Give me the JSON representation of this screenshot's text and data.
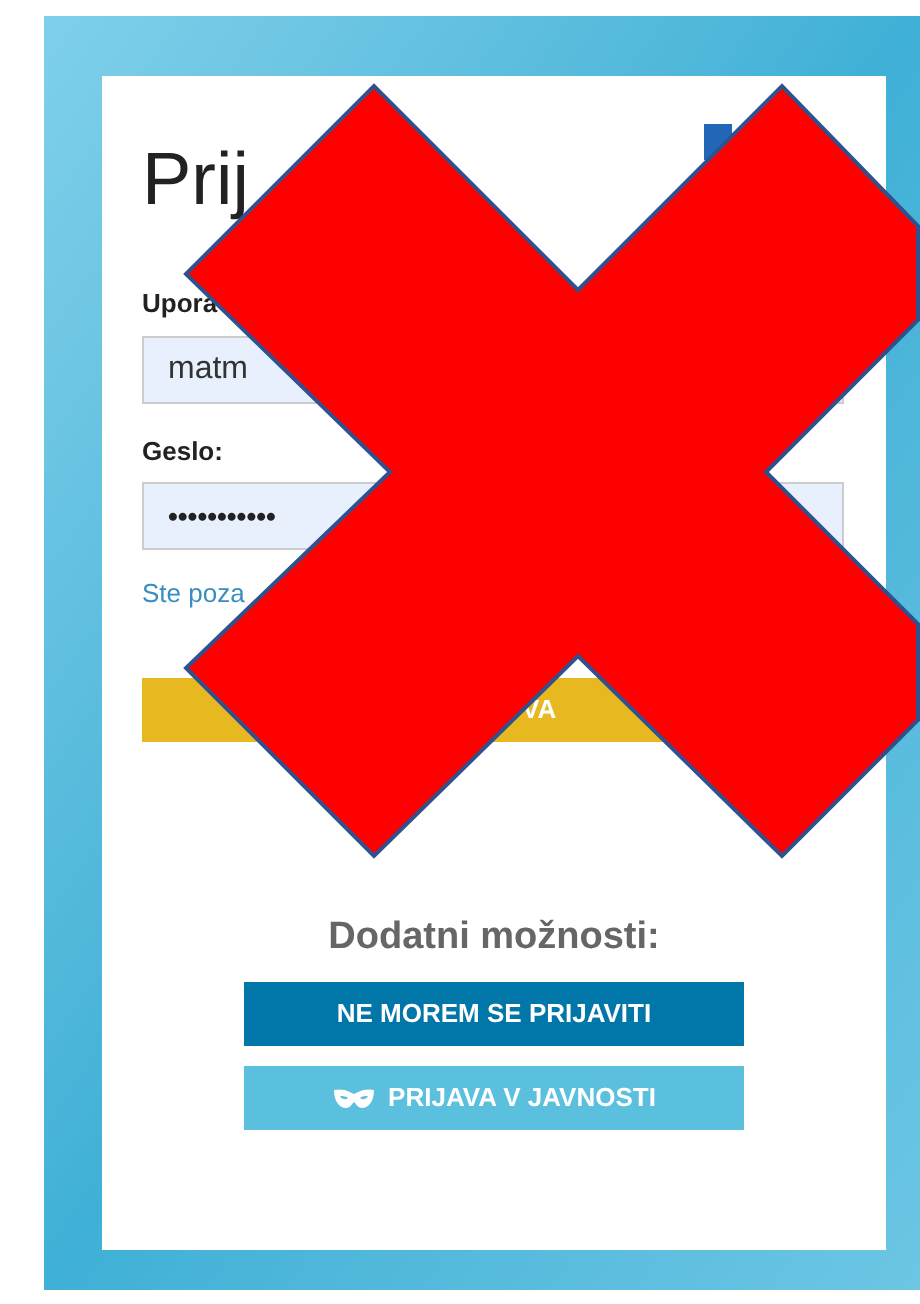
{
  "login_card": {
    "title": "Prij",
    "username": {
      "label": "Upora",
      "value": "matm"
    },
    "password": {
      "label": "Geslo:",
      "value": "•••••••••••"
    },
    "forgot_link": "Ste poza",
    "login_button": "VA"
  },
  "more_options": {
    "heading": "Dodatni možnosti:",
    "buttons": [
      {
        "kind": "primary",
        "label": "NE MOREM SE PRIJAVITI"
      },
      {
        "kind": "mask",
        "label": "PRIJAVA V JAVNOSTI"
      }
    ]
  }
}
